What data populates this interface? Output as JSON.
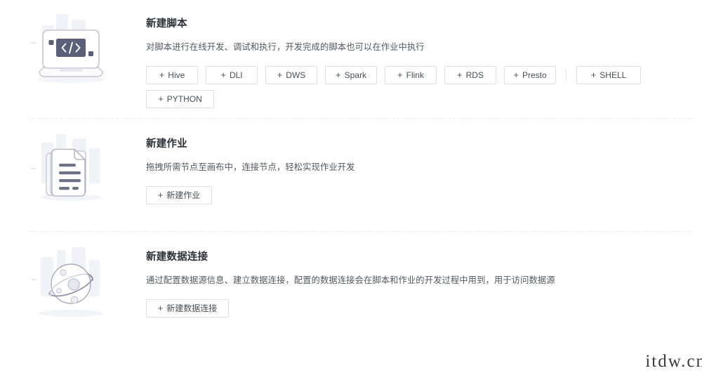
{
  "sections": [
    {
      "id": "new-script",
      "title": "新建脚本",
      "description": "对脚本进行在线开发、调试和执行，开发完成的脚本也可以在作业中执行",
      "illustration": "laptop-code-icon",
      "buttons": [
        {
          "label": "Hive",
          "prefix": "+"
        },
        {
          "label": "DLI",
          "prefix": "+"
        },
        {
          "label": "DWS",
          "prefix": "+"
        },
        {
          "label": "Spark",
          "prefix": "+"
        },
        {
          "label": "Flink",
          "prefix": "+"
        },
        {
          "label": "RDS",
          "prefix": "+"
        },
        {
          "label": "Presto",
          "prefix": "+"
        },
        {
          "label": "SHELL",
          "prefix": "+"
        },
        {
          "label": "PYTHON",
          "prefix": "+"
        }
      ]
    },
    {
      "id": "new-job",
      "title": "新建作业",
      "description": "拖拽所需节点至画布中，连接节点，轻松实现作业开发",
      "illustration": "documents-icon",
      "buttons": [
        {
          "label": "新建作业",
          "prefix": "+"
        }
      ]
    },
    {
      "id": "new-data-connection",
      "title": "新建数据连接",
      "description": "通过配置数据源信息、建立数据连接，配置的数据连接会在脚本和作业的开发过程中用到，用于访问数据源",
      "illustration": "planet-icon",
      "buttons": [
        {
          "label": "新建数据连接",
          "prefix": "+"
        }
      ]
    }
  ],
  "watermark": {
    "text": "itdw.cn"
  },
  "colors": {
    "title": "#2b2f36",
    "description": "#53575e",
    "button_border": "#dcdfe6",
    "button_text": "#4a4f57",
    "divider": "#e9eaee",
    "illustration_line": "#9a9cb0",
    "illustration_fill": "#5b5f78",
    "background": "#ffffff"
  }
}
